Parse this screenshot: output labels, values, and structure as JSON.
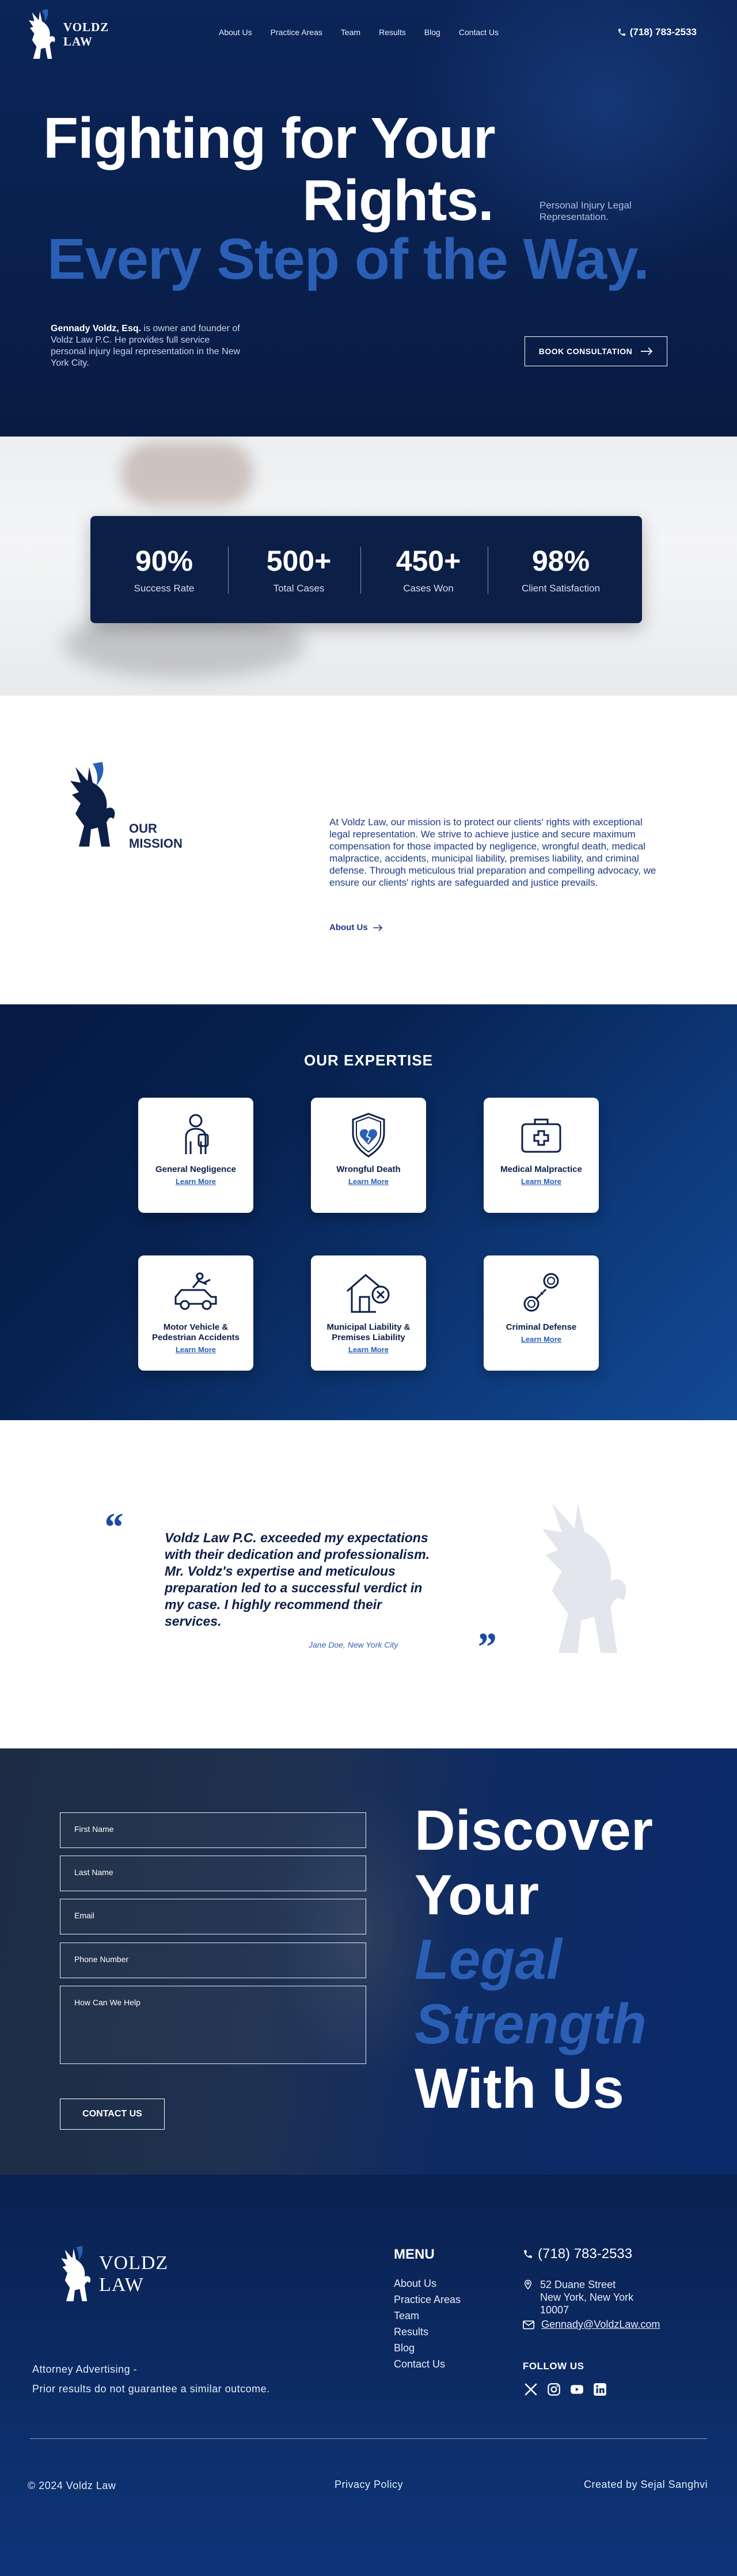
{
  "nav": {
    "logo_line1": "VOLDZ",
    "logo_line2": "LAW",
    "links": [
      "About Us",
      "Practice Areas",
      "Team",
      "Results",
      "Blog",
      "Contact Us"
    ],
    "phone": "(718) 783-2533"
  },
  "hero": {
    "line1": "Fighting for Your",
    "line2": "Rights.",
    "line3": "Every Step of the Way.",
    "tagline": "Personal Injury Legal Representation.",
    "bio_name": "Gennady Voldz, Esq.",
    "bio_rest": " is owner and founder of Voldz Law P.C. He provides full service personal injury legal representation in the New York City.",
    "cta": "BOOK CONSULTATION"
  },
  "stats": [
    {
      "value": "90%",
      "label": "Success Rate"
    },
    {
      "value": "500+",
      "label": "Total Cases"
    },
    {
      "value": "450+",
      "label": "Cases Won"
    },
    {
      "value": "98%",
      "label": "Client Satisfaction"
    }
  ],
  "mission": {
    "title_line1": "OUR",
    "title_line2": "MISSION",
    "text": "At Voldz Law, our mission is to protect our clients' rights with exceptional legal representation. We strive to achieve justice and secure maximum compensation for those impacted by negligence, wrongful death, medical malpractice, accidents, municipal liability, premises liability, and criminal defense. Through meticulous trial preparation and compelling advocacy, we ensure our clients' rights are safeguarded and justice prevails.",
    "link": "About Us"
  },
  "expertise": {
    "title": "OUR EXPERTISE",
    "link_label": "Learn More",
    "cards": [
      {
        "title": "General Negligence",
        "icon": "injured-person-icon"
      },
      {
        "title": "Wrongful Death",
        "icon": "broken-heart-shield-icon"
      },
      {
        "title": "Medical Malpractice",
        "icon": "medical-kit-icon"
      },
      {
        "title": "Motor Vehicle & Pedestrian Accidents",
        "icon": "car-accident-icon"
      },
      {
        "title": "Municipal Liability & Premises Liability",
        "icon": "damaged-house-icon"
      },
      {
        "title": "Criminal Defense",
        "icon": "handcuffs-icon"
      }
    ]
  },
  "testimonial": {
    "open_quote": "“",
    "close_quote": "”",
    "text": "Voldz Law P.C. exceeded my expectations with their dedication and professionalism. Mr. Voldz's expertise and meticulous preparation led to a successful verdict in my case. I highly recommend their services.",
    "author": "Jane Doe, New York City"
  },
  "contact": {
    "fields": [
      "First Name",
      "Last Name",
      "Email",
      "Phone Number",
      "How Can We Help"
    ],
    "button": "CONTACT US",
    "headline": [
      "Discover",
      "Your",
      "Legal",
      "Strength",
      "With Us"
    ]
  },
  "footer": {
    "logo_line1": "VOLDZ",
    "logo_line2": "LAW",
    "menu_title": "MENU",
    "menu": [
      "About Us",
      "Practice Areas",
      "Team",
      "Results",
      "Blog",
      "Contact Us"
    ],
    "phone": "(718) 783-2533",
    "address": [
      "52 Duane Street",
      "New York, New York",
      "10007"
    ],
    "email": "Gennady@VoldzLaw.com",
    "advertising_line1": "Attorney Advertising -",
    "advertising_line2": "Prior results do not guarantee a similar outcome.",
    "follow": "FOLLOW US",
    "social": [
      "x-icon",
      "instagram-icon",
      "youtube-icon",
      "linkedin-icon"
    ],
    "copyright": "© 2024 Voldz Law",
    "privacy": "Privacy Policy",
    "credit": "Created by Sejal Sanghvi"
  },
  "colors": {
    "navy": "#0c1f47",
    "accent_blue": "#2a5fb5",
    "white": "#ffffff"
  }
}
